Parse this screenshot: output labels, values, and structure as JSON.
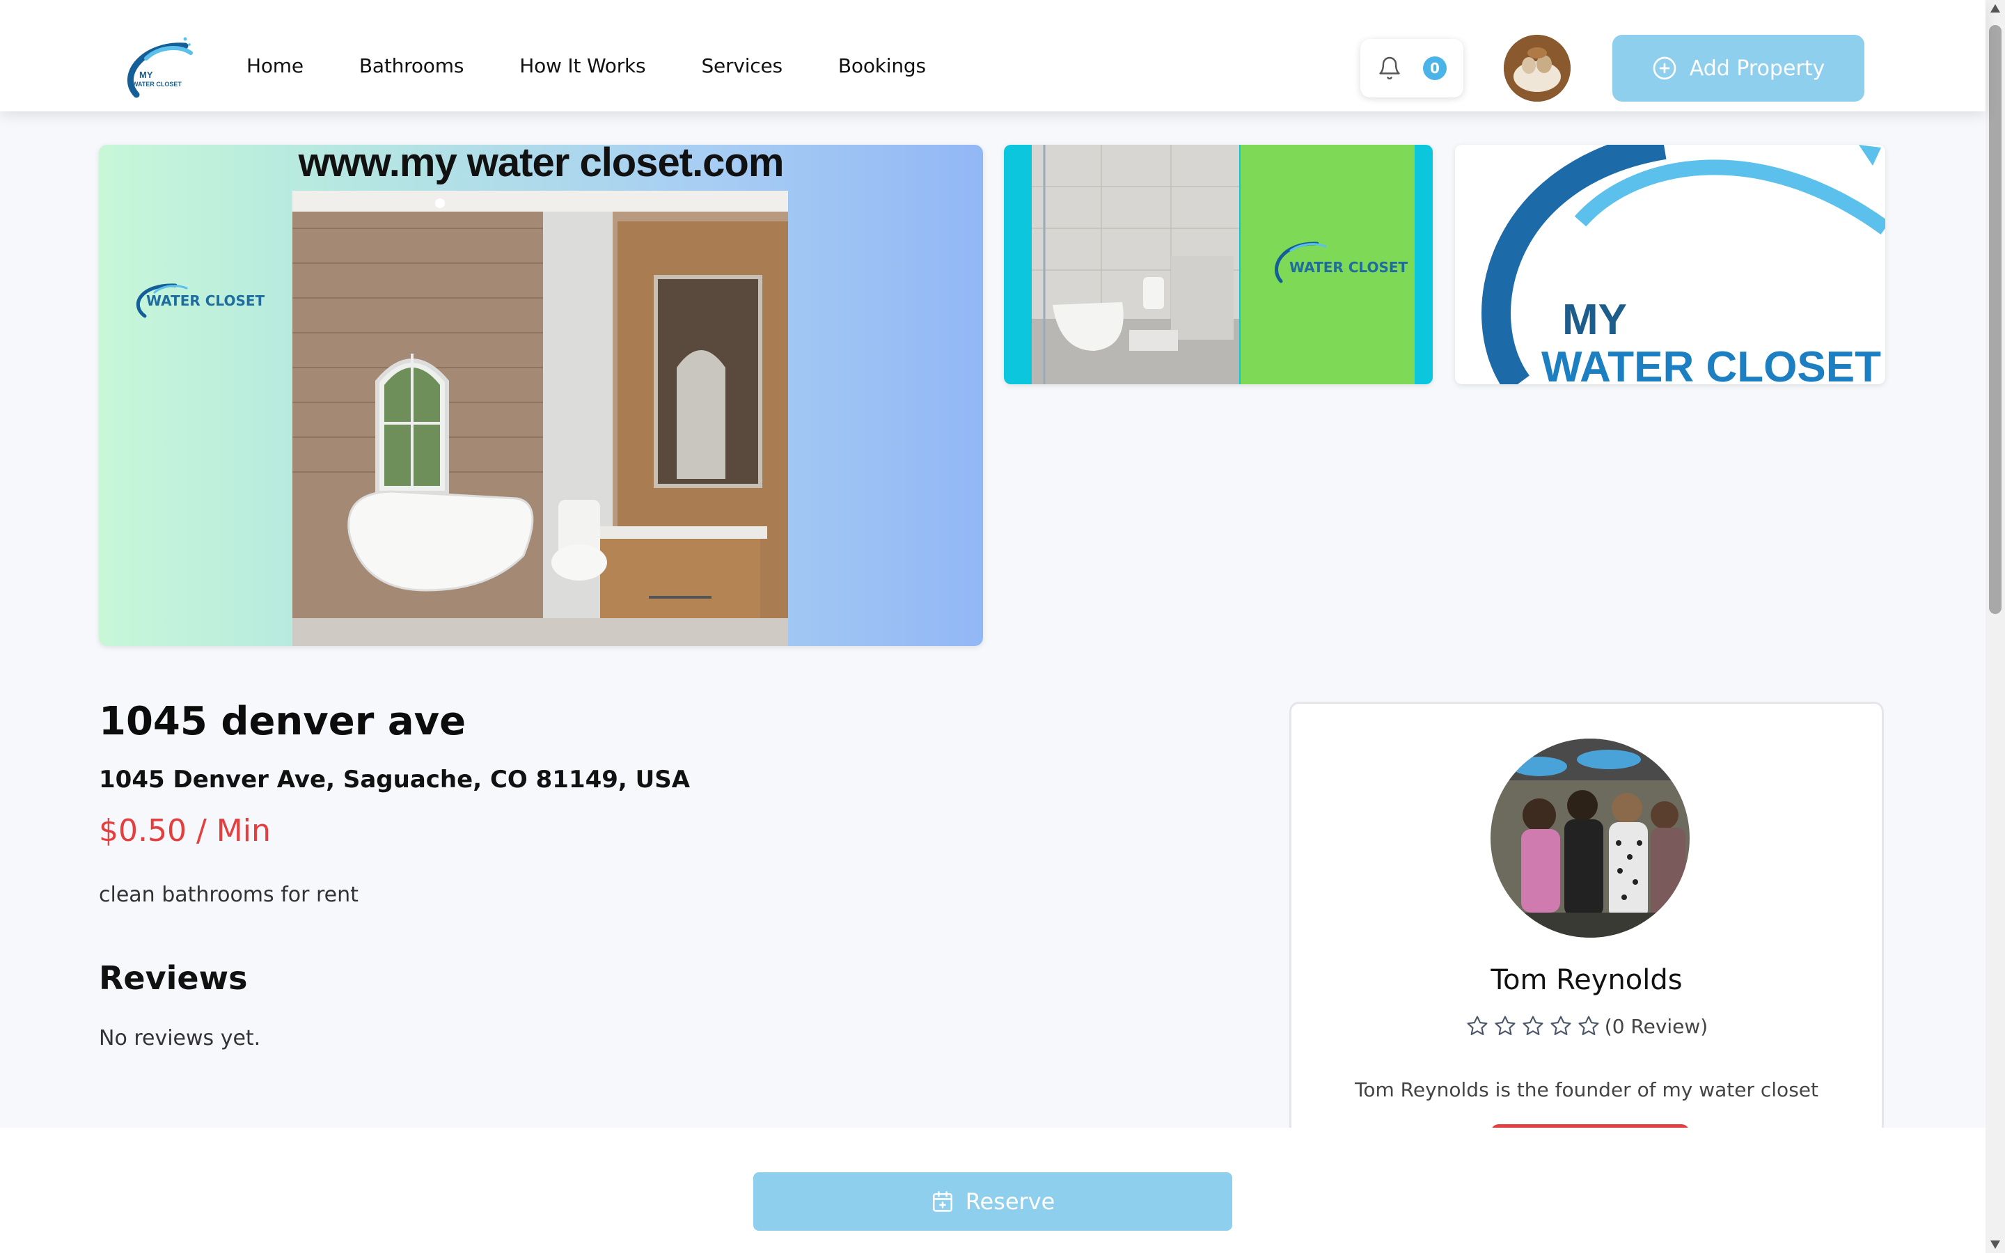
{
  "header": {
    "logo_text_top": "MY",
    "logo_text_bottom": "WATER CLOSET",
    "nav": [
      {
        "label": "Home"
      },
      {
        "label": "Bathrooms"
      },
      {
        "label": "How It Works"
      },
      {
        "label": "Services"
      },
      {
        "label": "Bookings"
      }
    ],
    "notification_count": "0",
    "add_property_label": "Add Property"
  },
  "gallery": {
    "main_banner_url": "www.my water closet.com",
    "main_logo_text": "WATER CLOSET",
    "thumb1_logo_text": "WATER CLOSET",
    "thumb2_line1": "MY",
    "thumb2_line2": "WATER CLOSET"
  },
  "listing": {
    "title": "1045 denver ave",
    "address": "1045 Denver Ave, Saguache, CO 81149, USA",
    "price": "$0.50 / Min",
    "description": "clean bathrooms for rent",
    "reviews_heading": "Reviews",
    "no_reviews": "No reviews yet."
  },
  "host": {
    "name": "Tom Reynolds",
    "rating_stars": 0,
    "review_count": "(0 Review)",
    "bio": "Tom Reynolds is the founder of my water closet"
  },
  "footer": {
    "reserve_label": "Reserve"
  },
  "colors": {
    "accent": "#8ecfee",
    "price": "#e53e3e",
    "badge": "#4ab4e8"
  }
}
